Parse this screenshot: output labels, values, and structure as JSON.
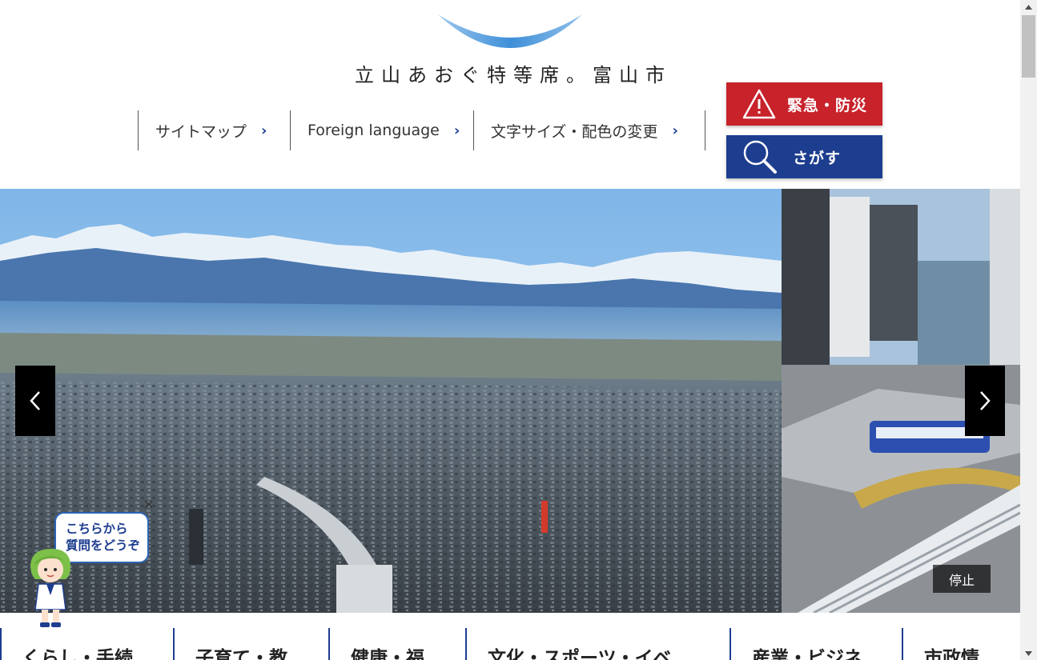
{
  "header": {
    "logo_text": "立山あおぐ特等席。富山市",
    "util_nav": [
      {
        "label": "サイトマップ",
        "chevron": "›"
      },
      {
        "label": "Foreign language",
        "chevron": "›"
      },
      {
        "label": "文字サイズ・配色の変更",
        "chevron": "›"
      }
    ],
    "emergency_button": {
      "label": "緊急・防災",
      "icon": "warning-triangle-icon",
      "color": "#c8222b"
    },
    "search_button": {
      "label": "さがす",
      "icon": "magnifier-icon",
      "color": "#1d3d8f"
    }
  },
  "hero": {
    "prev_icon": "‹",
    "next_icon": "›",
    "stop_label": "停止"
  },
  "chat": {
    "close_icon": "×",
    "bubble_line1": "こちらから",
    "bubble_line2": "質問をどうぞ"
  },
  "global_nav": [
    {
      "label": "くらし・手続"
    },
    {
      "label": "子育て・教"
    },
    {
      "label": "健康・福"
    },
    {
      "label": "文化・スポーツ・イベ"
    },
    {
      "label": "産業・ビジネ"
    },
    {
      "label": "市政情"
    }
  ],
  "colors": {
    "brand_blue": "#1d3d8f",
    "emergency_red": "#c8222b",
    "accent_sky": "#3f8fd8"
  }
}
